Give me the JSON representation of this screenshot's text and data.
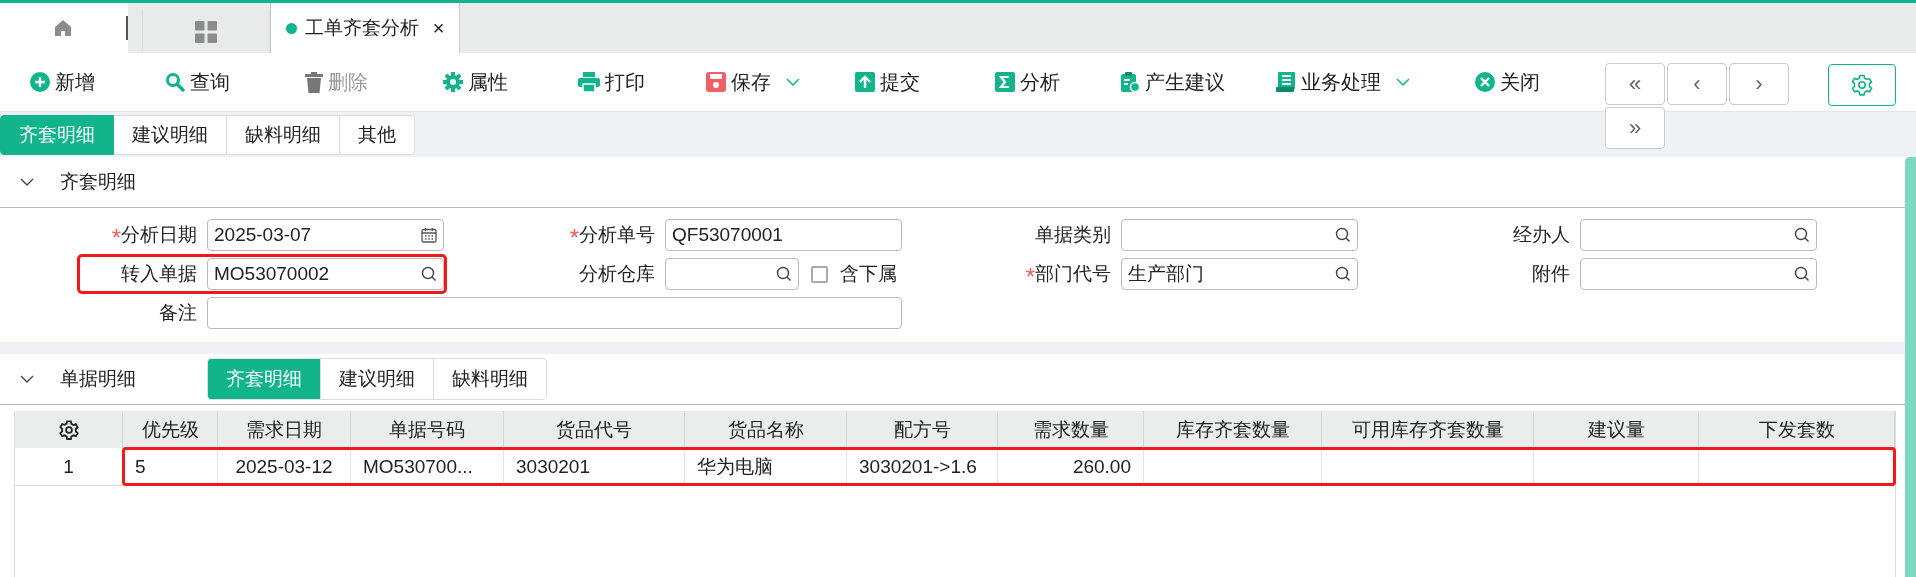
{
  "window_tabs": [
    {
      "kind": "home"
    },
    {
      "kind": "grid"
    },
    {
      "kind": "doc",
      "label": "工单齐套分析",
      "selected": true,
      "close": "×"
    }
  ],
  "toolbar": [
    {
      "label": "新增",
      "kind": "plus",
      "disabled": false,
      "dropdown": false
    },
    {
      "label": "查询",
      "kind": "search",
      "disabled": false,
      "dropdown": false
    },
    {
      "label": "删除",
      "kind": "trash",
      "disabled": true,
      "dropdown": false
    },
    {
      "label": "属性",
      "kind": "gear",
      "disabled": false,
      "dropdown": false
    },
    {
      "label": "打印",
      "kind": "print",
      "disabled": false,
      "dropdown": false
    },
    {
      "label": "保存",
      "kind": "save",
      "disabled": false,
      "dropdown": true
    },
    {
      "label": "提交",
      "kind": "upload",
      "disabled": false,
      "dropdown": false
    },
    {
      "label": "分析",
      "kind": "sigma",
      "disabled": false,
      "dropdown": false
    },
    {
      "label": "产生建议",
      "kind": "clipboard",
      "disabled": false,
      "dropdown": false
    },
    {
      "label": "业务处理",
      "kind": "list",
      "disabled": false,
      "dropdown": true
    },
    {
      "label": "关闭",
      "kind": "close",
      "disabled": false,
      "dropdown": false
    }
  ],
  "nav_buttons": [
    "«",
    "‹",
    "›",
    "»"
  ],
  "page_tabs": [
    {
      "label": "齐套明细",
      "selected": true
    },
    {
      "label": "建议明细",
      "selected": false
    },
    {
      "label": "缺料明细",
      "selected": false
    },
    {
      "label": "其他",
      "selected": false
    }
  ],
  "header_section": {
    "title": "齐套明细",
    "expanded": true,
    "rows": [
      [
        {
          "label": "分析日期",
          "required_mark": "*",
          "kind": "date",
          "value": "2025-03-07",
          "highlighted": false
        },
        {
          "label": "分析单号",
          "required_mark": "*",
          "kind": "text",
          "value": "QF53070001",
          "highlighted": false
        },
        {
          "label": "单据类别",
          "kind": "lookup",
          "highlighted": false
        },
        {
          "label": "经办人",
          "kind": "lookup",
          "highlighted": false
        }
      ],
      [
        {
          "label": "转入单据",
          "kind": "lookup",
          "value": "MO53070002",
          "highlighted": true
        },
        {
          "label": "分析仓库",
          "kind": "lookup",
          "highlighted": false,
          "checkbox": {
            "label": "含下属",
            "checked": false
          }
        },
        {
          "label": "部门代号",
          "required_mark": "*",
          "kind": "lookup",
          "value": "生产部门",
          "highlighted": false
        },
        {
          "label": "附件",
          "kind": "lookup",
          "highlighted": false
        }
      ],
      [
        {
          "label": "备注",
          "kind": "wide",
          "highlighted": false
        }
      ]
    ]
  },
  "detail_section": {
    "title": "单据明细",
    "expanded": true,
    "tabs": [
      {
        "label": "齐套明细",
        "selected": true
      },
      {
        "label": "建议明细",
        "selected": false
      },
      {
        "label": "缺料明细",
        "selected": false
      }
    ],
    "table": {
      "columns": [
        "优先级",
        "需求日期",
        "单据号码",
        "货品代号",
        "货品名称",
        "配方号",
        "需求数量",
        "库存齐套数量",
        "可用库存齐套数量",
        "建议量",
        "下发套数"
      ],
      "rows": [
        {
          "number": "1",
          "highlighted": true,
          "cells": [
            "5",
            "2025-03-12",
            "MO530700...",
            "3030201",
            "华为电脑",
            "3030201->1.6",
            "260.00",
            null,
            null,
            null,
            null
          ]
        }
      ]
    }
  }
}
